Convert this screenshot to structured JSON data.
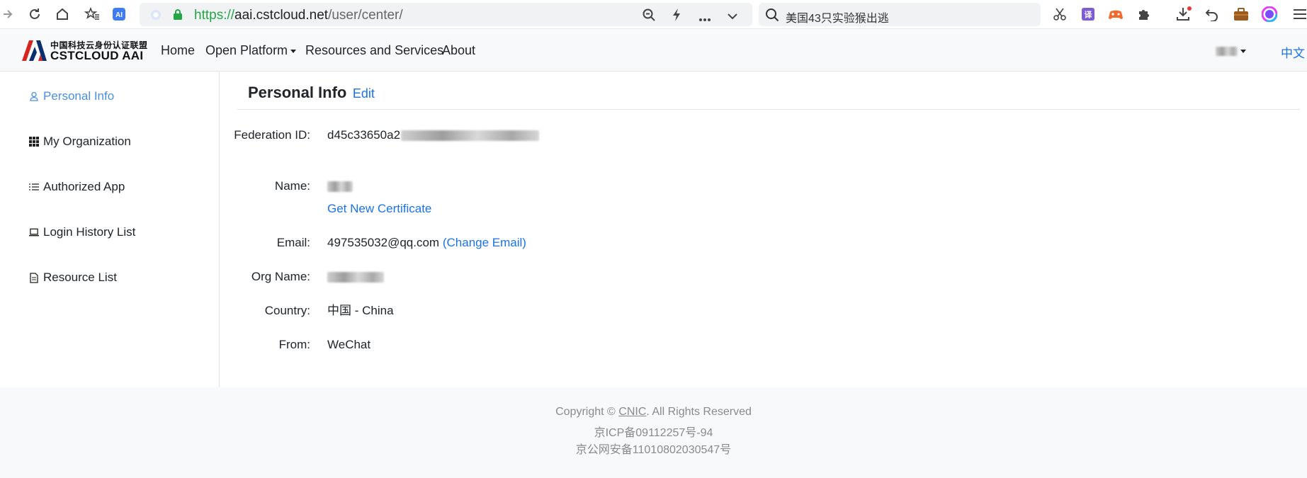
{
  "browser": {
    "url_scheme": "https://",
    "url_host": "aai.cstcloud.net",
    "url_path": "/user/center/",
    "search_text": "美国43只实验猴出逃",
    "extension_translate_label": "译"
  },
  "navbar": {
    "logo_cn": "中国科技云身份认证联盟",
    "logo_en": "CSTCLOUD AAI",
    "links": {
      "home": "Home",
      "open_platform": "Open Platform",
      "resources": "Resources and Services",
      "about": "About"
    },
    "lang": "中文"
  },
  "sidebar": {
    "items": [
      {
        "label": "Personal Info",
        "icon": "person-icon"
      },
      {
        "label": "My Organization",
        "icon": "grid-icon"
      },
      {
        "label": "Authorized App",
        "icon": "list-icon"
      },
      {
        "label": "Login History List",
        "icon": "laptop-icon"
      },
      {
        "label": "Resource List",
        "icon": "file-icon"
      }
    ]
  },
  "main": {
    "title": "Personal Info",
    "edit": "Edit",
    "fields": {
      "federation_id_label": "Federation ID:",
      "federation_id_value": "d45c33650a2",
      "name_label": "Name:",
      "get_certificate": "Get New Certificate",
      "email_label": "Email:",
      "email_value": "497535032@qq.com",
      "change_email": "(Change Email)",
      "org_label": "Org Name:",
      "org_value_prefix": " ",
      "country_label": "Country:",
      "country_value": "中国 - China",
      "from_label": "From:",
      "from_value": "WeChat"
    }
  },
  "footer": {
    "copyright_prefix": "Copyright ©",
    "copyright_link": "CNIC",
    "copyright_suffix": ". All Rights Reserved",
    "icp": "京ICP备09112257号-94",
    "police": "京公网安备11010802030547号"
  }
}
